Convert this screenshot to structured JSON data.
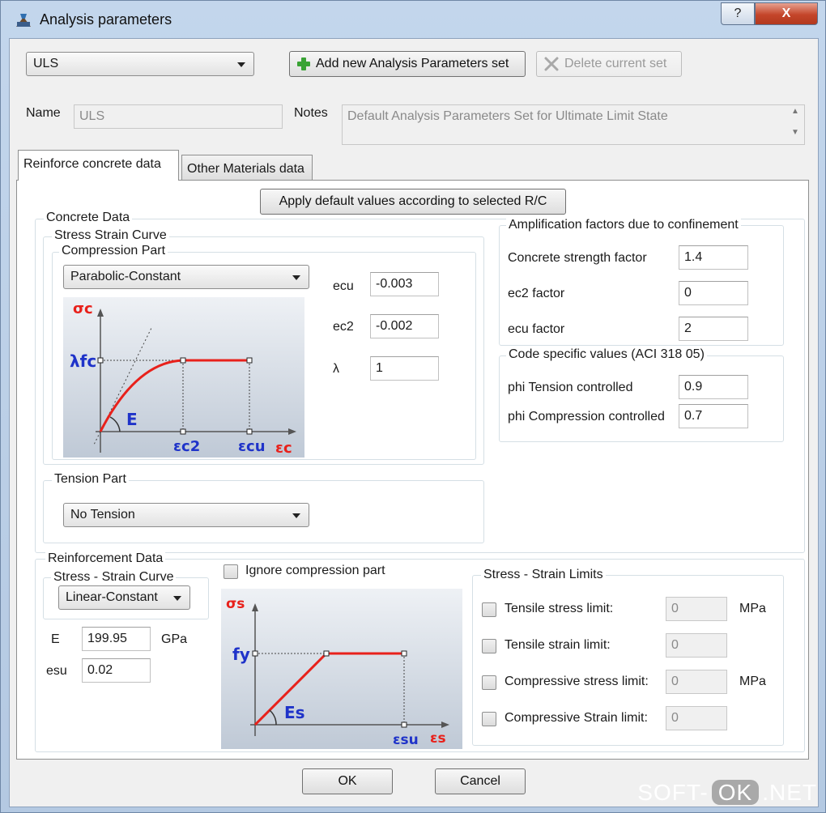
{
  "window": {
    "title": "Analysis parameters",
    "help_label": "?",
    "close_label": "X"
  },
  "toolbar": {
    "set_select_value": "ULS",
    "add_button_label": "Add new Analysis Parameters set",
    "delete_button_label": "Delete current set"
  },
  "fields": {
    "name_label": "Name",
    "name_value": "ULS",
    "notes_label": "Notes",
    "notes_value": "Default Analysis Parameters Set for Ultimate Limit State"
  },
  "tabs": [
    {
      "label": "Reinforce concrete data",
      "active": true
    },
    {
      "label": "Other Materials data",
      "active": false
    }
  ],
  "apply_button_label": "Apply default values according to selected R/C",
  "concrete": {
    "group_label": "Concrete Data",
    "stress_strain_label": "Stress Strain Curve",
    "compression_label": "Compression Part",
    "compression_value": "Parabolic-Constant",
    "params": [
      {
        "label": "ecu",
        "value": "-0.003"
      },
      {
        "label": "ec2",
        "value": "-0.002"
      },
      {
        "label": "λ",
        "value": "1"
      }
    ],
    "diagram": {
      "sigma_c": "σc",
      "lambda_fc": "λfc",
      "E": "E",
      "eps_c2": "εc2",
      "eps_cu": "εcu",
      "eps_c": "εc"
    },
    "tension_label": "Tension Part",
    "tension_value": "No Tension"
  },
  "amplification": {
    "group_label": "Amplification factors due to confinement",
    "rows": [
      {
        "label": "Concrete strength factor",
        "value": "1.4"
      },
      {
        "label": "ec2 factor",
        "value": "0"
      },
      {
        "label": "ecu factor",
        "value": "2"
      }
    ]
  },
  "code_values": {
    "group_label": "Code specific values (ACI 318 05)",
    "rows": [
      {
        "label": "phi Tension controlled",
        "value": "0.9"
      },
      {
        "label": "phi Compression controlled",
        "value": "0.7"
      }
    ]
  },
  "reinforcement": {
    "group_label": "Reinforcement Data",
    "curve_label": "Stress - Strain Curve",
    "curve_value": "Linear-Constant",
    "E_label": "E",
    "E_value": "199.95",
    "E_unit": "GPa",
    "esu_label": "esu",
    "esu_value": "0.02",
    "ignore_label": "Ignore compression part",
    "diagram": {
      "sigma_s": "σs",
      "fy": "fy",
      "Es": "Es",
      "eps_su": "εsu",
      "eps_s": "εs"
    }
  },
  "limits": {
    "group_label": "Stress - Strain Limits",
    "rows": [
      {
        "label": "Tensile stress limit:",
        "value": "0",
        "unit": "MPa"
      },
      {
        "label": "Tensile strain limit:",
        "value": "0",
        "unit": ""
      },
      {
        "label": "Compressive stress limit:",
        "value": "0",
        "unit": "MPa"
      },
      {
        "label": "Compressive Strain limit:",
        "value": "0",
        "unit": ""
      }
    ]
  },
  "footer": {
    "ok_label": "OK",
    "cancel_label": "Cancel"
  },
  "watermark": {
    "left": "SOFT-",
    "mid": "OK",
    "right": ".NET"
  }
}
